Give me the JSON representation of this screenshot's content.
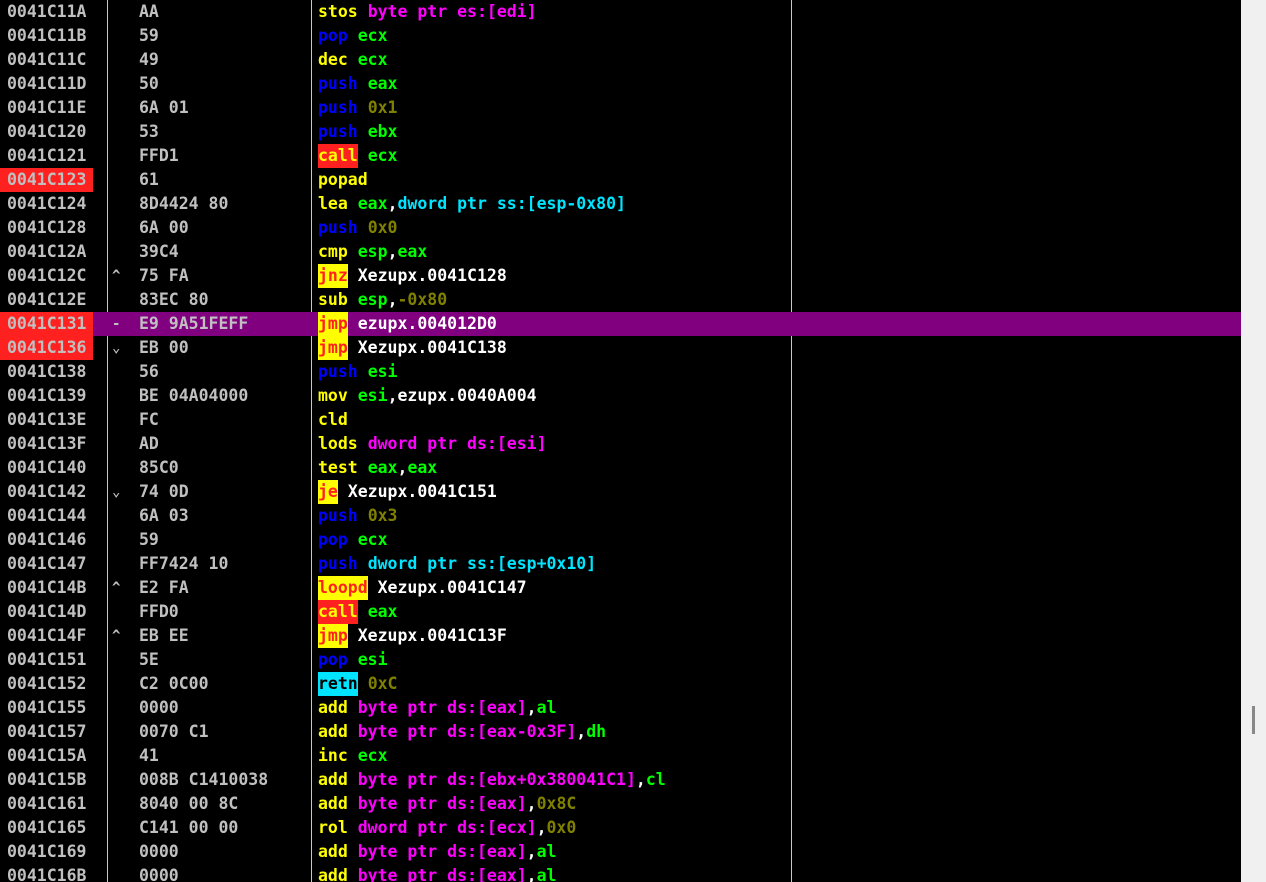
{
  "colors": {
    "mnemonic": "#ffff00",
    "push_pop": "#0000ff",
    "register": "#00ff00",
    "memory": "#ff00ff",
    "ss_memory": "#00e5ff",
    "immediate": "#808000",
    "label": "#ffffff",
    "breakpoint_bg": "#ff2020",
    "selection_bg": "#800080"
  },
  "rows": [
    {
      "addr": "0041C11A",
      "marker": "",
      "hex": "AA",
      "parts": [
        {
          "t": "stos",
          "c": "mn"
        },
        {
          "t": " ",
          "c": "sp"
        },
        {
          "t": "byte ptr es:[edi]",
          "c": "mem"
        }
      ]
    },
    {
      "addr": "0041C11B",
      "marker": "",
      "hex": "59",
      "parts": [
        {
          "t": "pop",
          "c": "pp"
        },
        {
          "t": " ",
          "c": "sp"
        },
        {
          "t": "ecx",
          "c": "reg"
        }
      ]
    },
    {
      "addr": "0041C11C",
      "marker": "",
      "hex": "49",
      "parts": [
        {
          "t": "dec",
          "c": "mn"
        },
        {
          "t": " ",
          "c": "sp"
        },
        {
          "t": "ecx",
          "c": "reg"
        }
      ]
    },
    {
      "addr": "0041C11D",
      "marker": "",
      "hex": "50",
      "parts": [
        {
          "t": "push",
          "c": "pp"
        },
        {
          "t": " ",
          "c": "sp"
        },
        {
          "t": "eax",
          "c": "reg"
        }
      ]
    },
    {
      "addr": "0041C11E",
      "marker": "",
      "hex": "6A 01",
      "parts": [
        {
          "t": "push",
          "c": "pp"
        },
        {
          "t": " ",
          "c": "sp"
        },
        {
          "t": "0x1",
          "c": "imm"
        }
      ]
    },
    {
      "addr": "0041C120",
      "marker": "",
      "hex": "53",
      "parts": [
        {
          "t": "push",
          "c": "pp"
        },
        {
          "t": " ",
          "c": "sp"
        },
        {
          "t": "ebx",
          "c": "reg"
        }
      ]
    },
    {
      "addr": "0041C121",
      "marker": "",
      "hex": "FFD1",
      "parts": [
        {
          "t": "call",
          "c": "call"
        },
        {
          "t": " ",
          "c": "sp"
        },
        {
          "t": "ecx",
          "c": "reg"
        }
      ]
    },
    {
      "addr": "0041C123",
      "marker": "",
      "hex": "61",
      "bp": true,
      "parts": [
        {
          "t": "popad",
          "c": "mn"
        }
      ]
    },
    {
      "addr": "0041C124",
      "marker": "",
      "hex": "8D4424 80",
      "parts": [
        {
          "t": "lea",
          "c": "mn"
        },
        {
          "t": " ",
          "c": "sp"
        },
        {
          "t": "eax",
          "c": "reg"
        },
        {
          "t": ",",
          "c": "lbl"
        },
        {
          "t": "dword ptr ss:[esp-0x80]",
          "c": "ss"
        }
      ]
    },
    {
      "addr": "0041C128",
      "marker": "",
      "hex": "6A 00",
      "parts": [
        {
          "t": "push",
          "c": "pp"
        },
        {
          "t": " ",
          "c": "sp"
        },
        {
          "t": "0x0",
          "c": "imm"
        }
      ]
    },
    {
      "addr": "0041C12A",
      "marker": "",
      "hex": "39C4",
      "parts": [
        {
          "t": "cmp",
          "c": "mn"
        },
        {
          "t": " ",
          "c": "sp"
        },
        {
          "t": "esp",
          "c": "reg"
        },
        {
          "t": ",",
          "c": "lbl"
        },
        {
          "t": "eax",
          "c": "reg"
        }
      ]
    },
    {
      "addr": "0041C12C",
      "marker": "^",
      "hex": "75 FA",
      "parts": [
        {
          "t": "jnz",
          "c": "jmp"
        },
        {
          "t": " ",
          "c": "sp"
        },
        {
          "t": "Xezupx.0041C128",
          "c": "lbl"
        }
      ]
    },
    {
      "addr": "0041C12E",
      "marker": "",
      "hex": "83EC 80",
      "parts": [
        {
          "t": "sub",
          "c": "mn"
        },
        {
          "t": " ",
          "c": "sp"
        },
        {
          "t": "esp",
          "c": "reg"
        },
        {
          "t": ",",
          "c": "lbl"
        },
        {
          "t": "-0x80",
          "c": "imm"
        }
      ]
    },
    {
      "addr": "0041C131",
      "marker": "-",
      "hex": "E9 9A51FEFF",
      "sel": true,
      "bp": true,
      "parts": [
        {
          "t": "jmp",
          "c": "jmp"
        },
        {
          "t": " ",
          "c": "sp"
        },
        {
          "t": "ezupx.004012D0",
          "c": "lbl"
        }
      ]
    },
    {
      "addr": "0041C136",
      "marker": "⌄",
      "hex": "EB 00",
      "bp": true,
      "parts": [
        {
          "t": "jmp",
          "c": "jmp"
        },
        {
          "t": " ",
          "c": "sp"
        },
        {
          "t": "Xezupx.0041C138",
          "c": "lbl"
        }
      ]
    },
    {
      "addr": "0041C138",
      "marker": "",
      "hex": "56",
      "parts": [
        {
          "t": "push",
          "c": "pp"
        },
        {
          "t": " ",
          "c": "sp"
        },
        {
          "t": "esi",
          "c": "reg"
        }
      ]
    },
    {
      "addr": "0041C139",
      "marker": "",
      "hex": "BE 04A04000",
      "parts": [
        {
          "t": "mov",
          "c": "mn"
        },
        {
          "t": " ",
          "c": "sp"
        },
        {
          "t": "esi",
          "c": "reg"
        },
        {
          "t": ",ezupx.0040A004",
          "c": "lbl"
        }
      ]
    },
    {
      "addr": "0041C13E",
      "marker": "",
      "hex": "FC",
      "parts": [
        {
          "t": "cld",
          "c": "mn"
        }
      ]
    },
    {
      "addr": "0041C13F",
      "marker": "",
      "hex": "AD",
      "parts": [
        {
          "t": "lods",
          "c": "mn"
        },
        {
          "t": " ",
          "c": "sp"
        },
        {
          "t": "dword ptr ds:[esi]",
          "c": "mem"
        }
      ]
    },
    {
      "addr": "0041C140",
      "marker": "",
      "hex": "85C0",
      "parts": [
        {
          "t": "test",
          "c": "mn"
        },
        {
          "t": " ",
          "c": "sp"
        },
        {
          "t": "eax",
          "c": "reg"
        },
        {
          "t": ",",
          "c": "lbl"
        },
        {
          "t": "eax",
          "c": "reg"
        }
      ]
    },
    {
      "addr": "0041C142",
      "marker": "⌄",
      "hex": "74 0D",
      "parts": [
        {
          "t": "je",
          "c": "jmp"
        },
        {
          "t": " ",
          "c": "sp"
        },
        {
          "t": "Xezupx.0041C151",
          "c": "lbl"
        }
      ]
    },
    {
      "addr": "0041C144",
      "marker": "",
      "hex": "6A 03",
      "parts": [
        {
          "t": "push",
          "c": "pp"
        },
        {
          "t": " ",
          "c": "sp"
        },
        {
          "t": "0x3",
          "c": "imm"
        }
      ]
    },
    {
      "addr": "0041C146",
      "marker": "",
      "hex": "59",
      "parts": [
        {
          "t": "pop",
          "c": "pp"
        },
        {
          "t": " ",
          "c": "sp"
        },
        {
          "t": "ecx",
          "c": "reg"
        }
      ]
    },
    {
      "addr": "0041C147",
      "marker": "",
      "hex": "FF7424 10",
      "parts": [
        {
          "t": "push",
          "c": "pp"
        },
        {
          "t": " ",
          "c": "sp"
        },
        {
          "t": "dword ptr ss:[esp+0x10]",
          "c": "ss"
        }
      ]
    },
    {
      "addr": "0041C14B",
      "marker": "^",
      "hex": "E2 FA",
      "parts": [
        {
          "t": "loopd",
          "c": "jmp"
        },
        {
          "t": " ",
          "c": "sp"
        },
        {
          "t": "Xezupx.0041C147",
          "c": "lbl"
        }
      ]
    },
    {
      "addr": "0041C14D",
      "marker": "",
      "hex": "FFD0",
      "parts": [
        {
          "t": "call",
          "c": "call"
        },
        {
          "t": " ",
          "c": "sp"
        },
        {
          "t": "eax",
          "c": "reg"
        }
      ]
    },
    {
      "addr": "0041C14F",
      "marker": "^",
      "hex": "EB EE",
      "parts": [
        {
          "t": "jmp",
          "c": "jmp"
        },
        {
          "t": " ",
          "c": "sp"
        },
        {
          "t": "Xezupx.0041C13F",
          "c": "lbl"
        }
      ]
    },
    {
      "addr": "0041C151",
      "marker": "",
      "hex": "5E",
      "parts": [
        {
          "t": "pop",
          "c": "pp"
        },
        {
          "t": " ",
          "c": "sp"
        },
        {
          "t": "esi",
          "c": "reg"
        }
      ]
    },
    {
      "addr": "0041C152",
      "marker": "",
      "hex": "C2 0C00",
      "parts": [
        {
          "t": "retn",
          "c": "ret"
        },
        {
          "t": " ",
          "c": "sp"
        },
        {
          "t": "0xC",
          "c": "imm"
        }
      ]
    },
    {
      "addr": "0041C155",
      "marker": "",
      "hex": "0000",
      "parts": [
        {
          "t": "add",
          "c": "mn"
        },
        {
          "t": " ",
          "c": "sp"
        },
        {
          "t": "byte ptr ds:[eax]",
          "c": "mem"
        },
        {
          "t": ",",
          "c": "lbl"
        },
        {
          "t": "al",
          "c": "reg"
        }
      ]
    },
    {
      "addr": "0041C157",
      "marker": "",
      "hex": "0070 C1",
      "parts": [
        {
          "t": "add",
          "c": "mn"
        },
        {
          "t": " ",
          "c": "sp"
        },
        {
          "t": "byte ptr ds:[eax-0x3F]",
          "c": "mem"
        },
        {
          "t": ",",
          "c": "lbl"
        },
        {
          "t": "dh",
          "c": "reg"
        }
      ]
    },
    {
      "addr": "0041C15A",
      "marker": "",
      "hex": "41",
      "parts": [
        {
          "t": "inc",
          "c": "mn"
        },
        {
          "t": " ",
          "c": "sp"
        },
        {
          "t": "ecx",
          "c": "reg"
        }
      ]
    },
    {
      "addr": "0041C15B",
      "marker": "",
      "hex": "008B C1410038",
      "parts": [
        {
          "t": "add",
          "c": "mn"
        },
        {
          "t": " ",
          "c": "sp"
        },
        {
          "t": "byte ptr ds:[ebx+0x380041C1]",
          "c": "mem"
        },
        {
          "t": ",",
          "c": "lbl"
        },
        {
          "t": "cl",
          "c": "reg"
        }
      ]
    },
    {
      "addr": "0041C161",
      "marker": "",
      "hex": "8040 00 8C",
      "parts": [
        {
          "t": "add",
          "c": "mn"
        },
        {
          "t": " ",
          "c": "sp"
        },
        {
          "t": "byte ptr ds:[eax]",
          "c": "mem"
        },
        {
          "t": ",",
          "c": "lbl"
        },
        {
          "t": "0x8C",
          "c": "imm"
        }
      ]
    },
    {
      "addr": "0041C165",
      "marker": "",
      "hex": "C141 00 00",
      "parts": [
        {
          "t": "rol",
          "c": "mn"
        },
        {
          "t": " ",
          "c": "sp"
        },
        {
          "t": "dword ptr ds:[ecx]",
          "c": "mem"
        },
        {
          "t": ",",
          "c": "lbl"
        },
        {
          "t": "0x0",
          "c": "imm"
        }
      ]
    },
    {
      "addr": "0041C169",
      "marker": "",
      "hex": "0000",
      "parts": [
        {
          "t": "add",
          "c": "mn"
        },
        {
          "t": " ",
          "c": "sp"
        },
        {
          "t": "byte ptr ds:[eax]",
          "c": "mem"
        },
        {
          "t": ",",
          "c": "lbl"
        },
        {
          "t": "al",
          "c": "reg"
        }
      ]
    },
    {
      "addr": "0041C16B",
      "marker": "",
      "hex": "0000",
      "parts": [
        {
          "t": "add",
          "c": "mn"
        },
        {
          "t": " ",
          "c": "sp"
        },
        {
          "t": "byte ptr ds:[eax]",
          "c": "mem"
        },
        {
          "t": ",",
          "c": "lbl"
        },
        {
          "t": "al",
          "c": "reg"
        }
      ]
    }
  ]
}
